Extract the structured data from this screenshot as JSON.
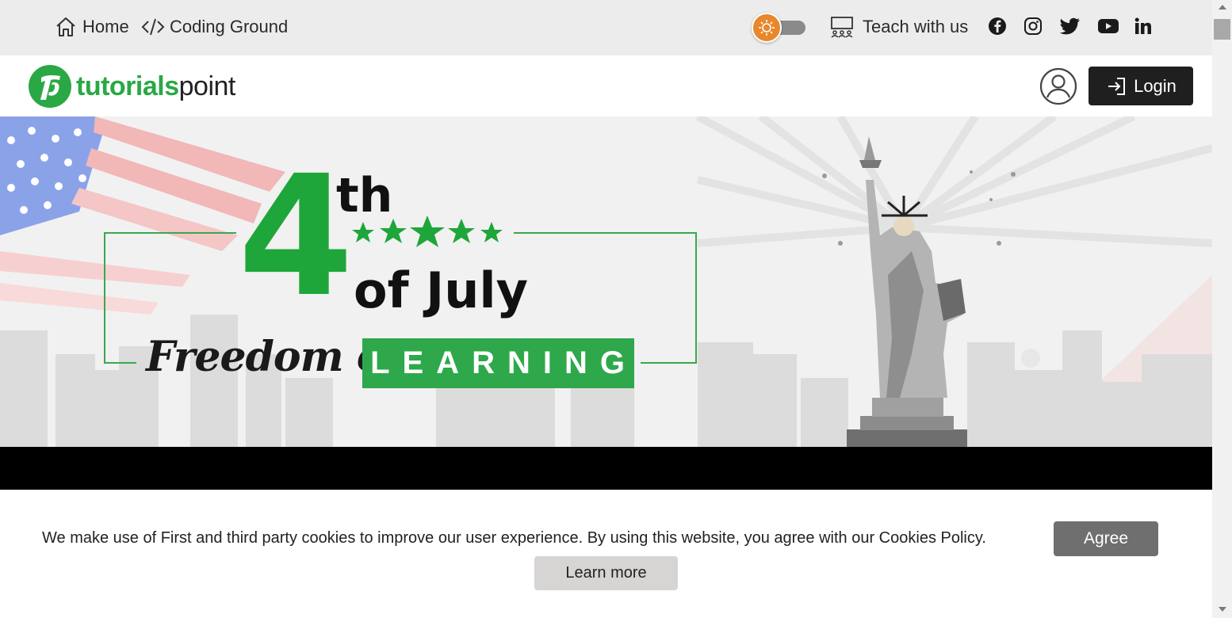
{
  "topbar": {
    "home_label": "Home",
    "coding_label": "Coding Ground",
    "teach_label": "Teach with us",
    "social": [
      "facebook-icon",
      "instagram-icon",
      "twitter-icon",
      "youtube-icon",
      "linkedin-icon"
    ]
  },
  "header": {
    "logo_part1": "tutorials",
    "logo_part2": "point",
    "login_label": "Login"
  },
  "banner": {
    "number": "4",
    "suffix": "th",
    "month": "of July",
    "tagline": "Freedom of",
    "highlight": "LEARNING"
  },
  "cookie": {
    "message": "We make use of First and third party cookies to improve our user experience. By using this website, you agree with our Cookies Policy.",
    "agree_label": "Agree",
    "learn_label": "Learn more"
  },
  "colors": {
    "brand_green": "#2aa845",
    "topbar_bg": "#ececec",
    "toggle_orange": "#e8872b",
    "login_bg": "#1f1f1f"
  }
}
